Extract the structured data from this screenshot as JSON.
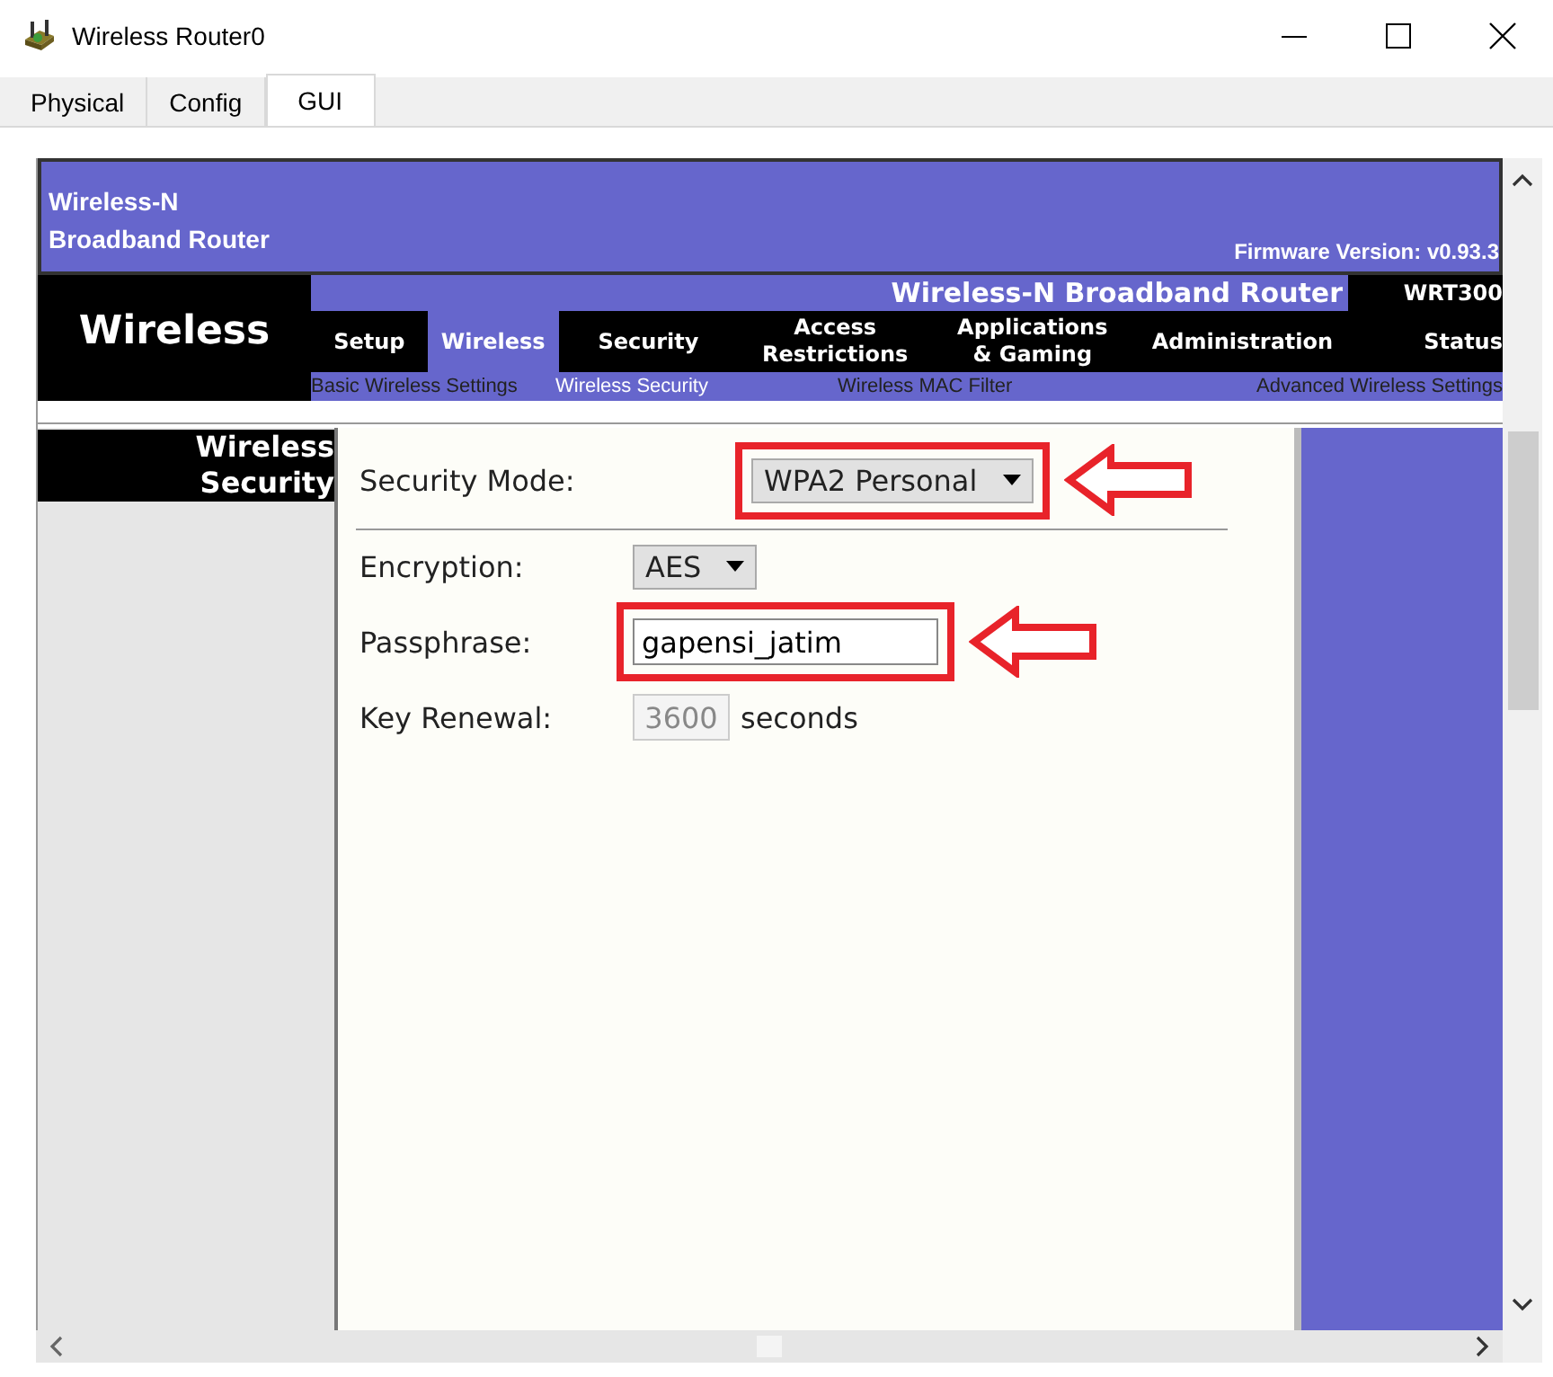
{
  "window": {
    "title": "Wireless Router0"
  },
  "tabs": [
    {
      "label": "Physical",
      "selected": false
    },
    {
      "label": "Config",
      "selected": false
    },
    {
      "label": "GUI",
      "selected": true
    }
  ],
  "router": {
    "header": {
      "brand_lines": [
        "Wireless-N",
        "Broadband Router"
      ],
      "firmware": "Firmware Version: v0.93.3"
    },
    "section": "Wireless",
    "product": "Wireless-N Broadband Router",
    "model": "WRT300",
    "nav": [
      {
        "label_lines": [
          "Setup"
        ],
        "selected": false
      },
      {
        "label_lines": [
          "Wireless"
        ],
        "selected": true
      },
      {
        "label_lines": [
          "Security"
        ],
        "selected": false
      },
      {
        "label_lines": [
          "Access",
          "Restrictions"
        ],
        "selected": false
      },
      {
        "label_lines": [
          "Applications",
          "& Gaming"
        ],
        "selected": false
      },
      {
        "label_lines": [
          "Administration"
        ],
        "selected": false
      },
      {
        "label_lines": [
          "Status"
        ],
        "selected": false
      }
    ],
    "subnav": [
      {
        "label": "Basic Wireless Settings",
        "selected": false
      },
      {
        "label": "Wireless Security",
        "selected": true
      },
      {
        "label": "Wireless MAC Filter",
        "selected": false
      },
      {
        "label": "Advanced Wireless Settings",
        "selected": false
      }
    ],
    "page_label": "Wireless Security",
    "form": {
      "mode": {
        "kind": "select",
        "label": "Security Mode:",
        "value": "WPA2 Personal",
        "highlighted": true
      },
      "rows": [
        {
          "kind": "select",
          "label": "Encryption:",
          "value": "AES",
          "highlighted": false
        },
        {
          "kind": "text",
          "label": "Passphrase:",
          "value": "gapensi_jatim",
          "highlighted": true
        },
        {
          "kind": "number",
          "label": "Key Renewal:",
          "value": "3600",
          "disabled": true,
          "unit": "seconds",
          "highlighted": false
        }
      ]
    }
  }
}
